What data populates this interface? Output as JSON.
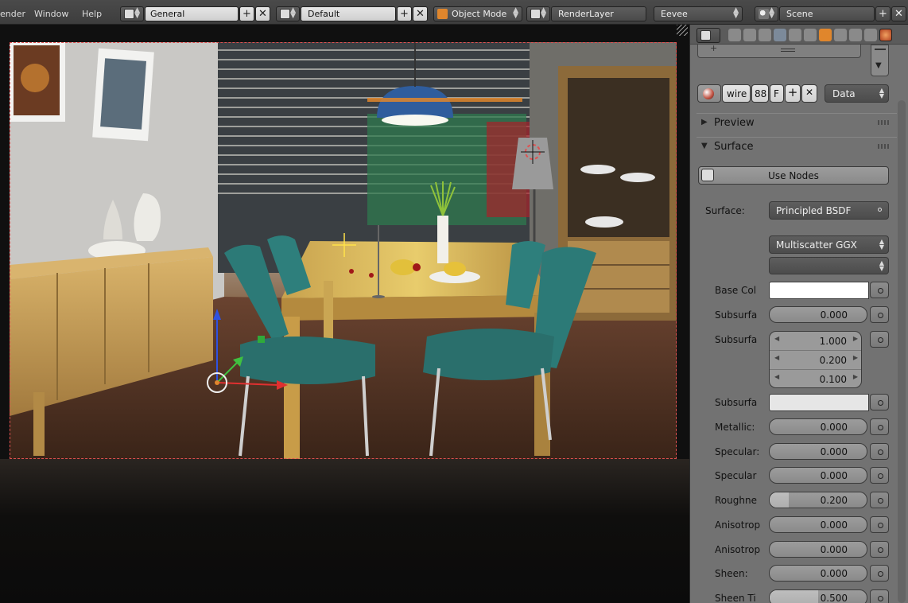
{
  "topbar": {
    "menu_render": "ender",
    "menu_window": "Window",
    "menu_help": "Help",
    "screen_layout": "General",
    "scene_layout": "Default",
    "mode": "Object Mode",
    "render_layer": "RenderLayer",
    "render_engine": "Eevee",
    "scene": "Scene",
    "plus_glyph": "+",
    "close_glyph": "✕"
  },
  "panel": {
    "material_name": "wire",
    "user_count": "88",
    "fake_user": "F",
    "link_type": "Data",
    "preview_label": "Preview",
    "surface_section_label": "Surface",
    "use_nodes_label": "Use Nodes",
    "surface_label": "Surface:",
    "surface_shader": "Principled BSDF",
    "distribution": "Multiscatter GGX",
    "subsurface_method": "",
    "base_color_label": "Base Col",
    "base_color": "#ffffff",
    "subsurface_label": "Subsurfa",
    "subsurface_value": "0.000",
    "subsurface_radius_label": "Subsurfa",
    "subsurface_radius": [
      "1.000",
      "0.200",
      "0.100"
    ],
    "subsurface_color_label": "Subsurfa",
    "subsurface_color": "#e6e6e6",
    "sliders": [
      {
        "label": "Metallic:",
        "value": "0.000",
        "fill": 0.0
      },
      {
        "label": "Specular:",
        "value": "0.000",
        "fill": 0.0
      },
      {
        "label": "Specular",
        "value": "0.000",
        "fill": 0.0
      },
      {
        "label": "Roughne",
        "value": "0.200",
        "fill": 0.2
      },
      {
        "label": "Anisotrop",
        "value": "0.000",
        "fill": 0.0
      },
      {
        "label": "Anisotrop",
        "value": "0.000",
        "fill": 0.0
      },
      {
        "label": "Sheen:",
        "value": "0.000",
        "fill": 0.0
      },
      {
        "label": "Sheen Ti",
        "value": "0.500",
        "fill": 0.5
      }
    ]
  },
  "colors": {
    "accent_orange": "#e0862c",
    "border_red": "#e05050",
    "panel_bg": "#727272"
  }
}
